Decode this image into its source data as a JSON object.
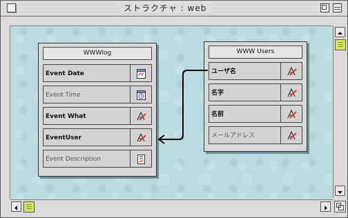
{
  "window": {
    "title": "ストラクチャ : web"
  },
  "entities": {
    "log": {
      "title": "WWWlog",
      "fields": [
        {
          "name": "Event Date",
          "style": "bold",
          "icon": "calendar-icon"
        },
        {
          "name": "Event Time",
          "style": "light",
          "icon": "clock-icon"
        },
        {
          "name": "Event What",
          "style": "bold",
          "icon": "text-field-icon"
        },
        {
          "name": "EventUser",
          "style": "bold",
          "icon": "text-field-icon"
        },
        {
          "name": "Event Description",
          "style": "light",
          "icon": "text-field-icon"
        }
      ]
    },
    "users": {
      "title": "WWW Users",
      "fields": [
        {
          "name": "ユーザ名",
          "style": "bold",
          "icon": "text-field-icon"
        },
        {
          "name": "名字",
          "style": "bold",
          "icon": "text-field-icon"
        },
        {
          "name": "名前",
          "style": "bold",
          "icon": "text-field-icon"
        },
        {
          "name": "メールアドレス",
          "style": "light",
          "icon": "text-field-icon"
        }
      ]
    }
  },
  "relation": {
    "from": "users.ユーザ名",
    "to": "log.EventUser"
  },
  "colors": {
    "canvas": "#b9dbe1",
    "scroll_thumb": "#d8e860",
    "text_icon_red": "#d43a3a"
  }
}
